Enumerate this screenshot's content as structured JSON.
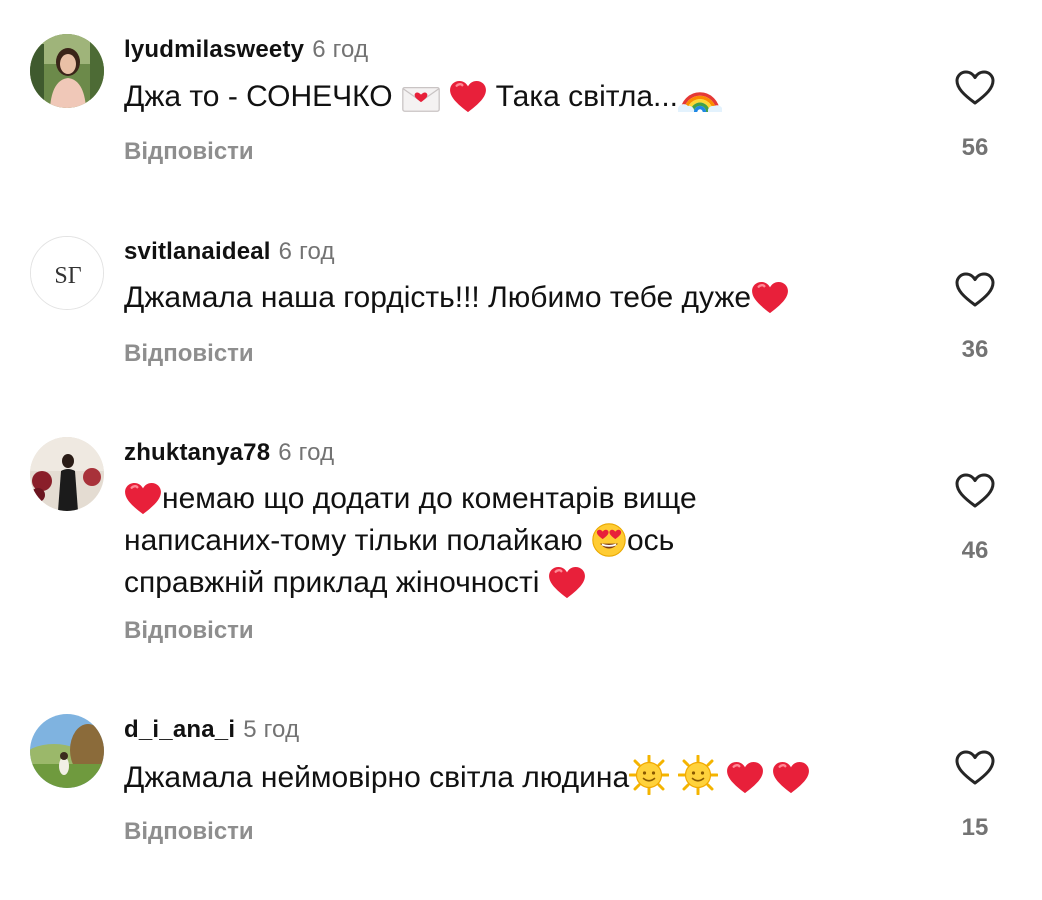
{
  "comments": [
    {
      "username": "lyudmilasweety",
      "time": "6 год",
      "text_parts": [
        "Джа то - СОНЕЧКО",
        "Така світла..."
      ],
      "emojis": [
        "love-letter",
        "red-heart",
        "rainbow"
      ],
      "reply_label": "Відповісти",
      "likes": "56"
    },
    {
      "username": "svitlanaideal",
      "time": "6 год",
      "text_parts": [
        "Джамала наша гордість!!! Любимо тебе дуже"
      ],
      "emojis": [
        "red-heart"
      ],
      "avatar_mark": "SГ",
      "reply_label": "Відповісти",
      "likes": "36"
    },
    {
      "username": "zhuktanya78",
      "time": "6 год",
      "text_parts": [
        "немаю що додати до коментарів вище",
        "написаних-тому тільки полайкаю",
        "ось",
        "справжній приклад жіночності"
      ],
      "emojis": [
        "red-heart",
        "heart-eyes",
        "red-heart"
      ],
      "reply_label": "Відповісти",
      "likes": "46"
    },
    {
      "username": "d_i_ana_i",
      "time": "5 год",
      "text_parts": [
        "Джамала неймовірно світла людина"
      ],
      "emojis": [
        "sun-face",
        "sun-face",
        "red-heart",
        "red-heart"
      ],
      "reply_label": "Відповісти",
      "likes": "15"
    }
  ],
  "colors": {
    "text": "#111111",
    "secondary": "#737373",
    "reply": "#8e8e8e",
    "heart": "#e8203a"
  }
}
